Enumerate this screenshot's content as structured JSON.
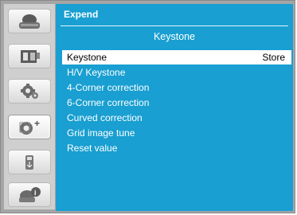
{
  "panel": {
    "title": "Expend",
    "subtitle": "Keystone"
  },
  "menu": [
    {
      "label": "Keystone",
      "value": "Store",
      "selected": true
    },
    {
      "label": "H/V Keystone"
    },
    {
      "label": "4-Corner correction"
    },
    {
      "label": "6-Corner correction"
    },
    {
      "label": "Curved correction"
    },
    {
      "label": "Grid image tune"
    },
    {
      "label": "Reset value"
    }
  ],
  "sidebar": {
    "icons": [
      "display-icon",
      "image-adjust-icon",
      "settings-gear-icon",
      "expand-settings-icon",
      "usb-icon",
      "info-icon"
    ],
    "active": "expand-settings-icon"
  },
  "colors": {
    "panel_bg": "#199fd1",
    "selected_bg": "#ffffff"
  }
}
